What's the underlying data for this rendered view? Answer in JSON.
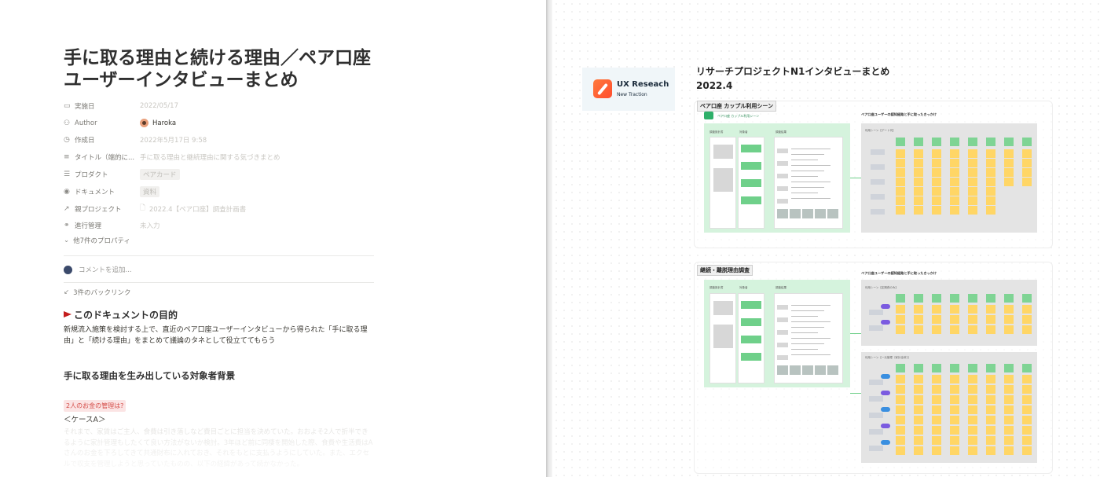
{
  "doc": {
    "title_line1": "手に取る理由と続ける理由／ペア口座",
    "title_line2": "ユーザーインタビューまとめ",
    "properties": [
      {
        "icon": "calendar-icon",
        "glyph": "▭",
        "label": "実施日",
        "value": "2022/05/17"
      },
      {
        "icon": "people-icon",
        "glyph": "⚇",
        "label": "Author",
        "value": "Haroka"
      },
      {
        "icon": "clock-icon",
        "glyph": "◷",
        "label": "作成日",
        "value": "2022年5月17日 9:58"
      },
      {
        "icon": "text-icon",
        "glyph": "≡",
        "label": "タイトル（端的に...",
        "value": "手に取る理由と継続理由に関する気づきまとめ"
      },
      {
        "icon": "list-icon",
        "glyph": "☰",
        "label": "プロダクト",
        "value": "ペアカード"
      },
      {
        "icon": "select-icon",
        "glyph": "◉",
        "label": "ドキュメント",
        "value": "資料"
      },
      {
        "icon": "arrow-icon",
        "glyph": "↗",
        "label": "親プロジェクト",
        "value": "2022.4【ペア口座】調査計画書"
      },
      {
        "icon": "link-icon",
        "glyph": "⚭",
        "label": "進行管理",
        "value": "未入力"
      }
    ],
    "more_props": "他7件のプロパティ",
    "comment_placeholder": "コメントを追加...",
    "backlinks": "3件のバックリンク",
    "purpose_heading": "このドキュメントの目的",
    "purpose_text": "新規流入施策を検討する上で、直近のペア口座ユーザーインタビューから得られた「手に取る理由」と「続ける理由」をまとめて議論のタネとして役立ててもらう",
    "bg_heading": "手に取る理由を生み出している対象者背景",
    "red_tag": "2人のお金の管理は?",
    "case_label": "＜ケースA＞",
    "faded_text": "それまで、家賃はご主人、食費は引き落しなど費目ごとに担当を決めていた。おおよそ2人で折半できるように家計管理もしたくて良い方法がないか検討。3年ほど前に同棲を開始した際、食費や生活費はAさんのお金を下ろしてきて共通財布に入れておき、それをもとに支払うようにしていた。また、エクセルで収支を管理しようと思っていたものの、以下の経緯があって続かなかった。"
  },
  "canvas": {
    "logo_title": "UX Reseach",
    "logo_sub": "New Traction",
    "title_line1": "リサーチプロジェクトN1インタビューまとめ",
    "title_line2": "2022.4",
    "frame1_label": "ペア口座 カップル利用シーン",
    "frame1_chip": "ペア口座 カップル利用シーン",
    "frame1_panel_title": "ペア口座ユーザーの認知経路と手に取ったきっかけ",
    "frame1_scene": "利用シーン【デート代】",
    "frame2_label": "継続・離脱理由調査",
    "frame2_panel_title": "ペア口座ユーザーの認知経路と手に取ったきっかけ",
    "frame2_scene_a": "利用シーン【定期費のみ】",
    "frame2_scene_b": "利用シーン【一元管理（家計全体）】",
    "col_headers": [
      "調査設計書",
      "対象者",
      "調査結果"
    ]
  },
  "colors": {
    "accent_green": "#2fb06a",
    "sticky_yellow": "#ffd666",
    "sticky_green": "#7fd494",
    "flag_red": "#c41d1d"
  }
}
